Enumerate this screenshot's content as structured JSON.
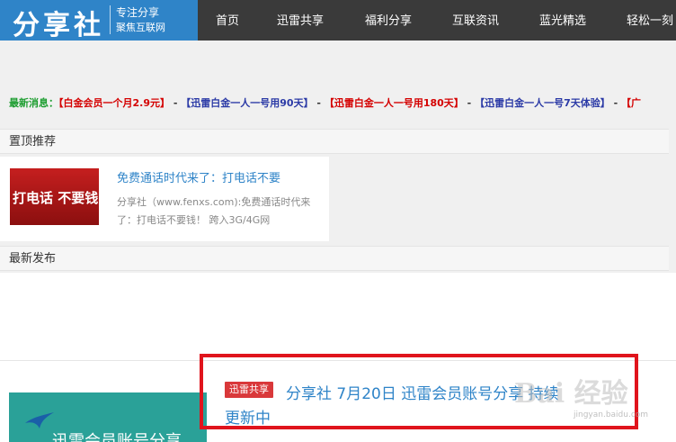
{
  "header": {
    "logo_text": "分享社",
    "logo_sub1": "专注分享",
    "logo_sub2": "聚焦互联网"
  },
  "nav": {
    "items": [
      "首页",
      "迅雷共享",
      "福利分享",
      "互联资讯",
      "蓝光精选",
      "轻松一刻"
    ]
  },
  "ticker": {
    "label": "最新消息：",
    "items": [
      {
        "text": "白金会员一个月2.9元",
        "color": "#d40000"
      },
      {
        "text": "迅雷白金一人一号用90天",
        "color": "#2b3aa6"
      },
      {
        "text": "迅雷白金一人一号用180天",
        "color": "#d40000"
      },
      {
        "text": "迅雷白金一人一号7天体验",
        "color": "#2b3aa6"
      },
      {
        "text": "广",
        "color": "#d40000"
      }
    ],
    "left_bracket": "【",
    "right_bracket": "】",
    "sep": "-"
  },
  "pinned": {
    "heading": "置顶推荐",
    "thumb_text": "打电话 不要钱",
    "title": "免费通话时代来了：打电话不要",
    "excerpt": "分享社（www.fenxs.com):免费通话时代来了：打电话不要钱！ 跨入3G/4G网"
  },
  "latest": {
    "heading": "最新发布",
    "post": {
      "tag": "迅雷共享",
      "title_line1": "分享社 7月20日 迅雷会员账号分享 持续",
      "title_line2": "更新中",
      "thumb_text": "迅雷会员账号分享"
    }
  },
  "watermark": {
    "text": "Bai 经验",
    "sub": "jingyan.baidu.com"
  },
  "colors": {
    "brand_blue": "#2f84c8",
    "topbar": "#3a3a3a",
    "tag_red": "#d9383a",
    "highlight_red": "#e0141c",
    "ticker_green": "#1c9d2f"
  }
}
